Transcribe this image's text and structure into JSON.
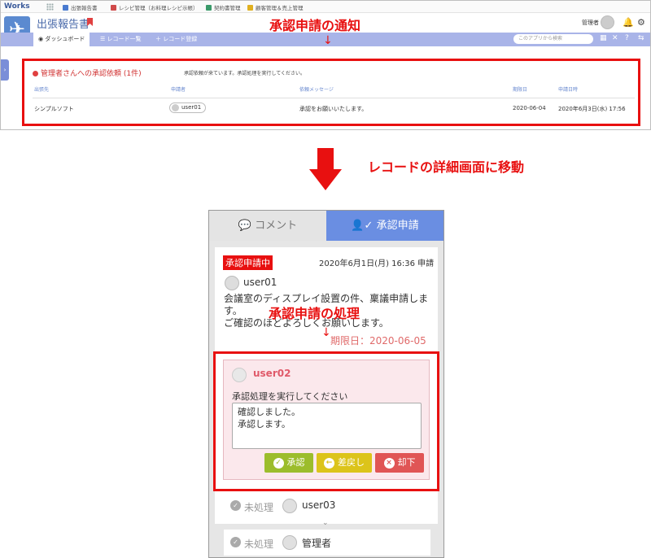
{
  "top_app": {
    "logo": "Works",
    "toolbar_apps": [
      {
        "label": "出張報告書",
        "color": "#4a7bd0"
      },
      {
        "label": "レシピ管理（お料理レシピ示帳）",
        "color": "#d04a4a"
      },
      {
        "label": "契約書管理",
        "color": "#3a9a6a"
      },
      {
        "label": "顧客管理＆売上管理",
        "color": "#e0b020"
      }
    ],
    "app_title": "出張報告書",
    "manager_label": "管理者",
    "nav_tabs": [
      "ダッシュボード",
      "レコード一覧",
      "レコード登録"
    ],
    "search_placeholder": "このアプリから検索",
    "notice": {
      "title": "管理者さんへの承認依頼 (1件)",
      "description": "承認依頼が来ています。承認処理を実行してください。",
      "headers": [
        "出張先",
        "申請者",
        "依頼メッセージ",
        "期限日",
        "申請日時"
      ],
      "row": {
        "destination": "シンプルソフト",
        "applicant": "user01",
        "message": "承認をお願いいたします。",
        "deadline": "2020-06-04",
        "applied_at": "2020年6月3日(水) 17:56"
      }
    }
  },
  "callouts": {
    "notification": "承認申請の通知",
    "move_to_detail": "レコードの詳細画面に移動",
    "processing": "承認申請の処理"
  },
  "mobile": {
    "tab_comment": "コメント",
    "tab_approval": "承認申請",
    "request": {
      "status": "承認申請中",
      "date": "2020年6月1日(月) 16:36 申請",
      "user": "user01",
      "message": "会議室のディスプレイ設置の件、稟議申請します。\nご確認のほどよろしくお願いします。",
      "deadline": "期限日：2020-06-05"
    },
    "approval": {
      "user": "user02",
      "prompt": "承認処理を実行してください",
      "comment": "確認しました。\n承認します。",
      "buttons": {
        "approve": "承認",
        "return": "差戻し",
        "reject": "却下"
      }
    },
    "pending": [
      {
        "status": "未処理",
        "user": "user03"
      },
      {
        "status": "未処理",
        "user": "管理者"
      }
    ]
  },
  "colors": {
    "accent": "#6a8ee2",
    "alert": "#e81010",
    "approve": "#9cbd2c",
    "return": "#dcc41a",
    "reject": "#e05555"
  }
}
